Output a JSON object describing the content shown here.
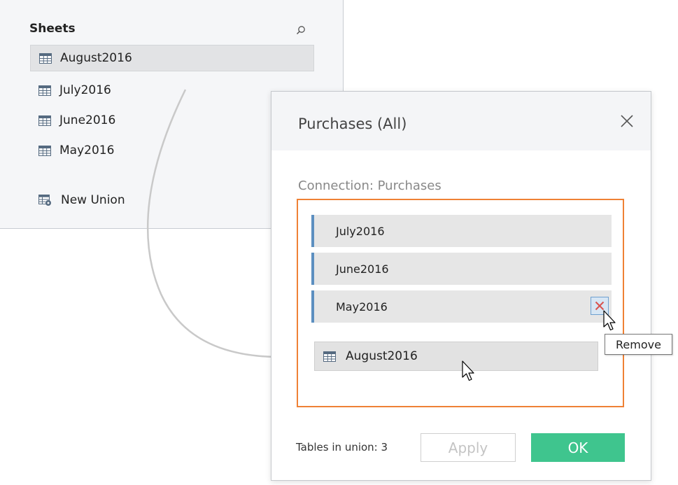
{
  "sheets": {
    "title": "Sheets",
    "items": [
      {
        "label": "August2016",
        "icon": "table-icon",
        "selected": true
      },
      {
        "label": "July2016",
        "icon": "table-icon"
      },
      {
        "label": "June2016",
        "icon": "table-icon"
      },
      {
        "label": "May2016",
        "icon": "table-icon"
      }
    ],
    "new_union": {
      "label": "New Union",
      "icon": "union-icon"
    }
  },
  "dialog": {
    "title": "Purchases (All)",
    "connection_label": "Connection: Purchases",
    "union_tables": [
      "July2016",
      "June2016",
      "May2016"
    ],
    "dragging_table": "August2016",
    "remove_tooltip": "Remove",
    "tables_in_union": "Tables in union: 3",
    "apply_label": "Apply",
    "ok_label": "OK"
  },
  "colors": {
    "accent_orange": "#ef8135",
    "ok_green": "#3fc58e",
    "row_marker_blue": "#5c8fc0",
    "remove_x_red": "#d9534f"
  }
}
